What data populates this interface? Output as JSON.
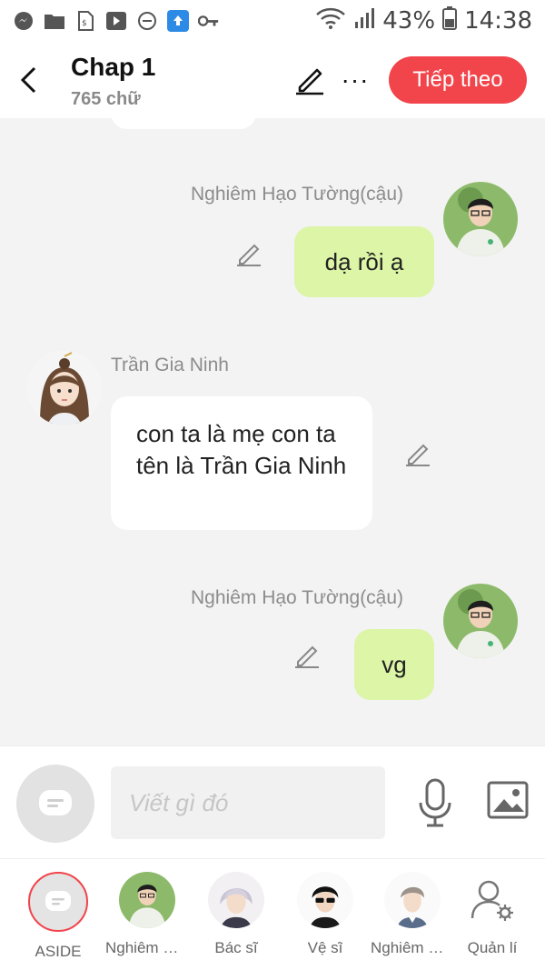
{
  "status_bar": {
    "battery": "43%",
    "time": "14:38",
    "left_icons": [
      "messenger-icon",
      "folder-icon",
      "sim-icon",
      "play-store-icon",
      "do-not-disturb-icon",
      "cloud-upload-icon",
      "key-icon"
    ]
  },
  "header": {
    "title": "Chap 1",
    "word_count": "765 chữ",
    "next_label": "Tiếp theo",
    "more_label": "···"
  },
  "messages": [
    {
      "side": "right",
      "name": "Nghiêm Hạo Tường(cậu)",
      "text": "dạ rồi ạ"
    },
    {
      "side": "left",
      "name": "Trần Gia Ninh",
      "text": "con ta là mẹ con ta tên là Trần Gia Ninh"
    },
    {
      "side": "right",
      "name": "Nghiêm Hạo Tường(cậu)",
      "text": "vg"
    }
  ],
  "composer": {
    "placeholder": "Viết gì đó"
  },
  "characters": [
    {
      "label": "ASIDE"
    },
    {
      "label": "Nghiêm Hạo Tường"
    },
    {
      "label": "Bác sĩ"
    },
    {
      "label": "Vệ sĩ"
    },
    {
      "label": "Nghiêm Hạo"
    },
    {
      "label": "Quản lí"
    }
  ],
  "colors": {
    "accent_red": "#f2444b",
    "bubble_green": "#dcf5a6",
    "background": "#f3f3f3"
  }
}
